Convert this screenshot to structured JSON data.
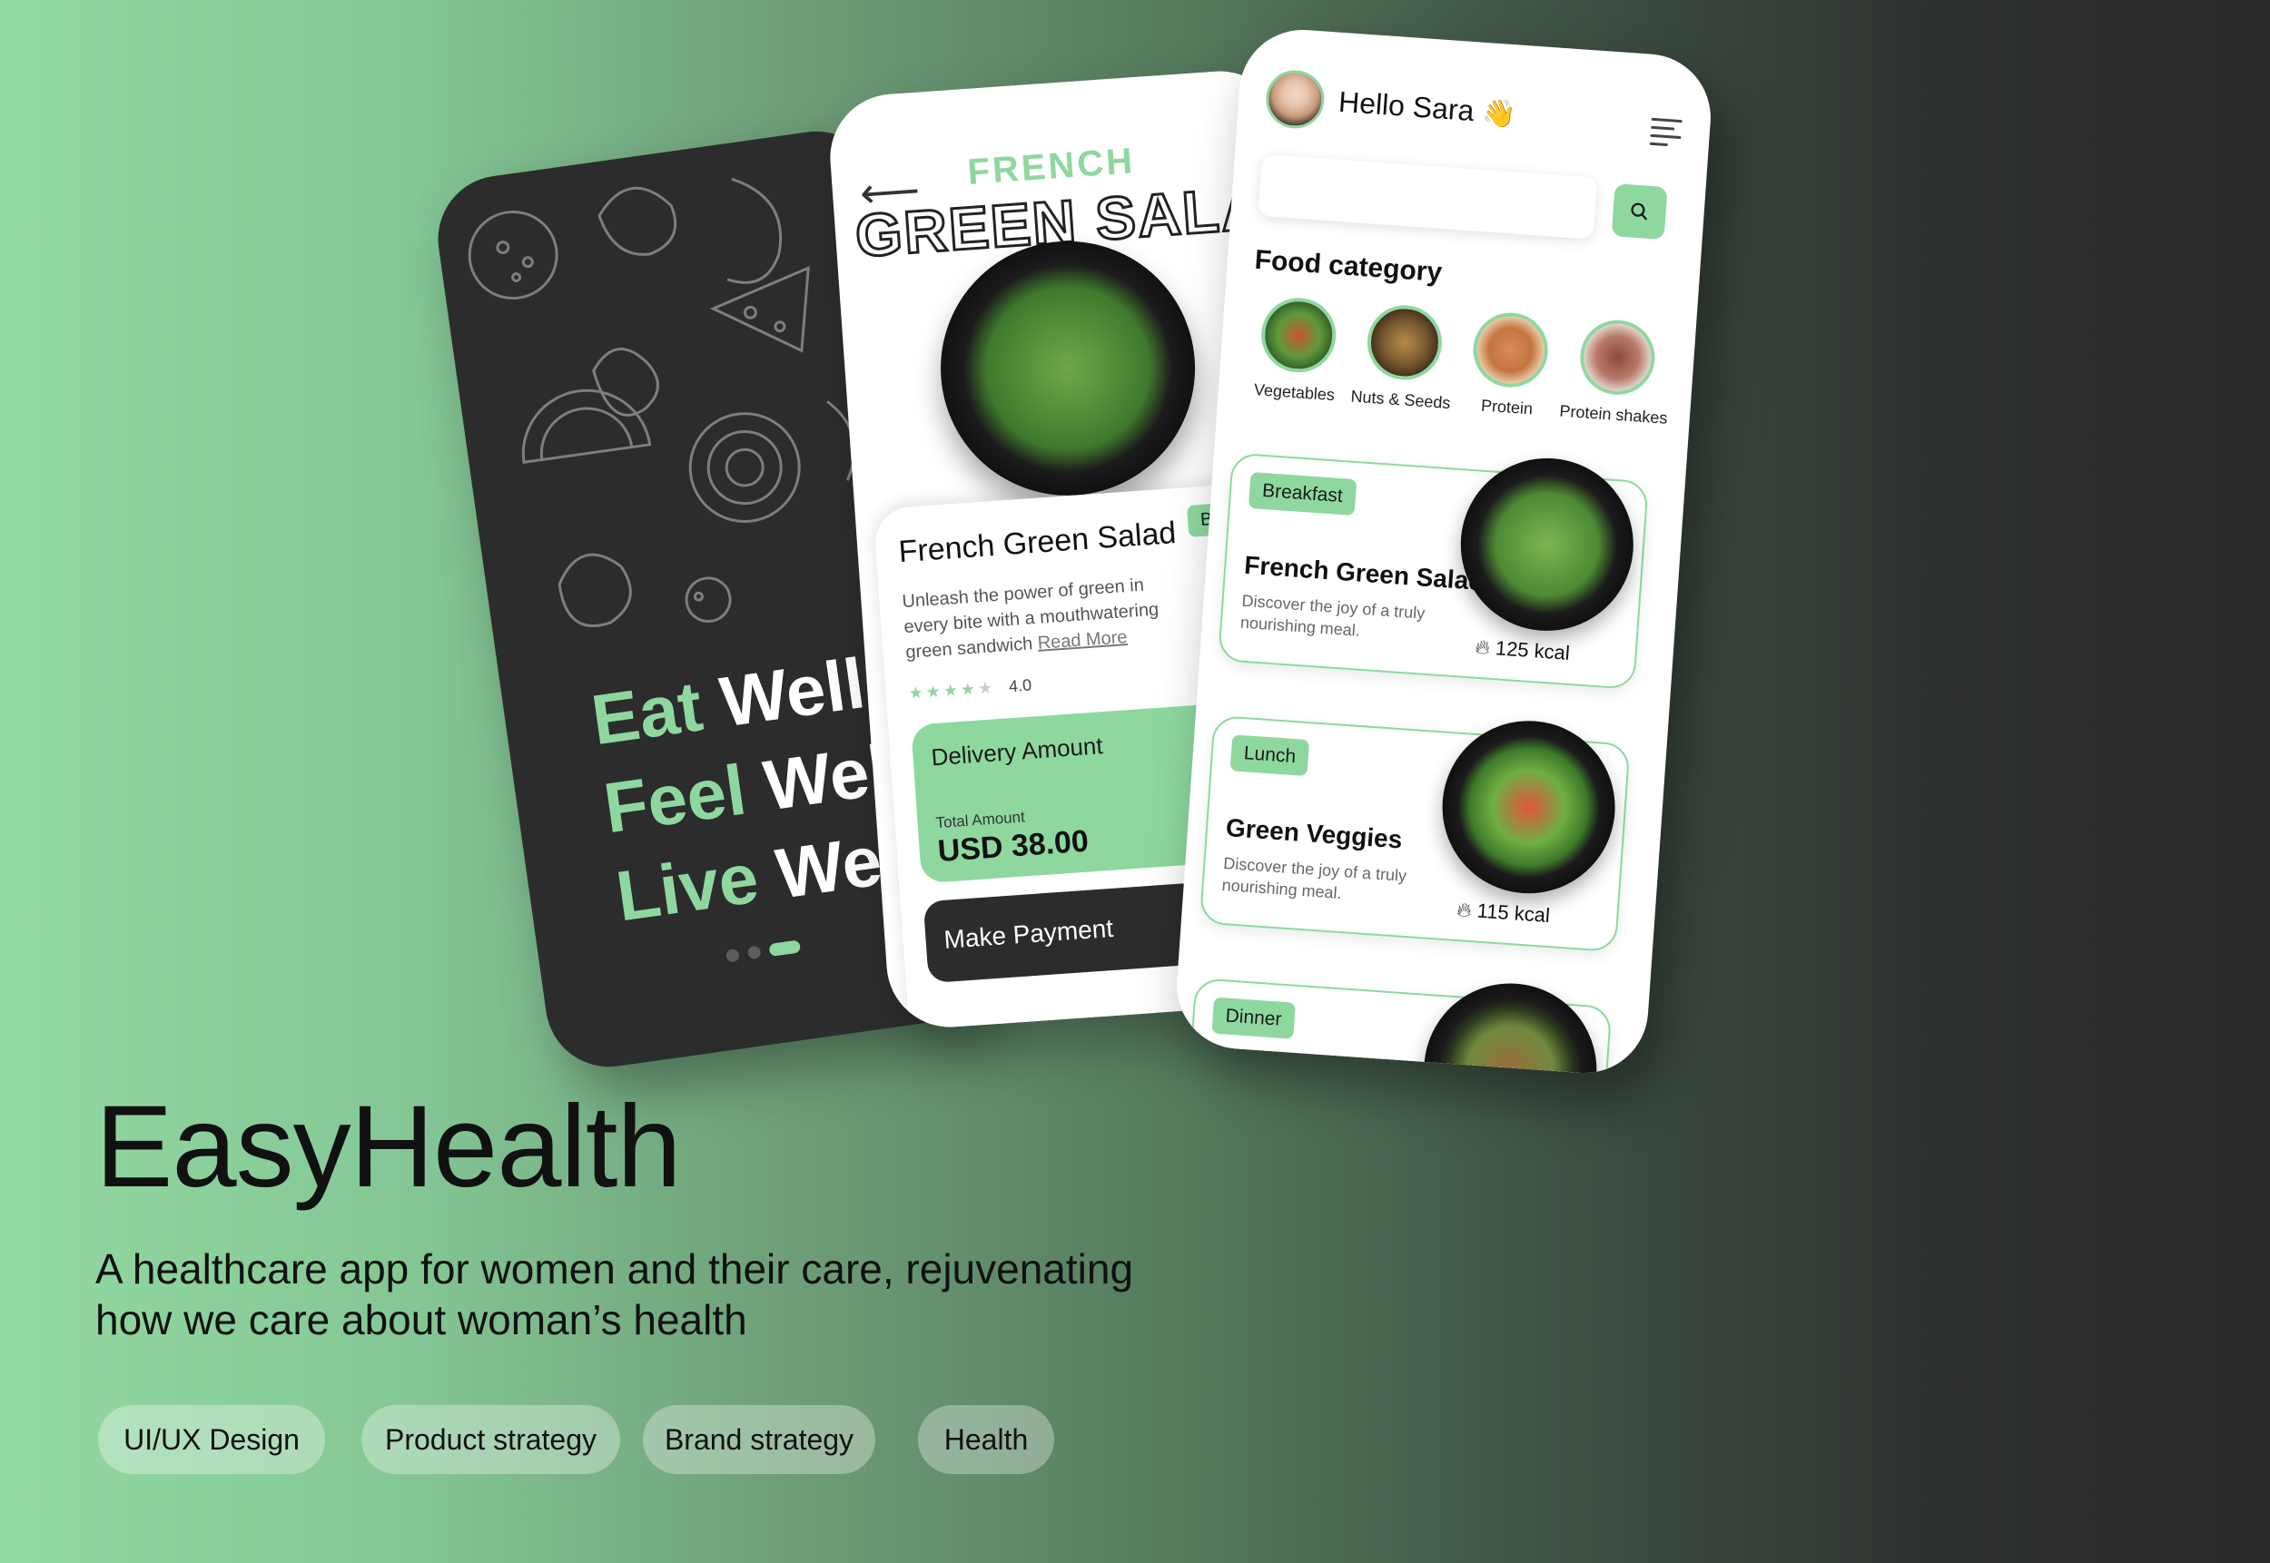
{
  "colors": {
    "accent": "#8ed8a0",
    "dark_card": "#2d2c2c",
    "white": "#ffffff"
  },
  "splash": {
    "slogan": [
      {
        "accent": "Eat",
        "word": "Well,"
      },
      {
        "accent": "Feel",
        "word": "Well"
      },
      {
        "accent": "Live",
        "word": "Well"
      }
    ],
    "pager_pages": 3,
    "pager_active": 3
  },
  "detail": {
    "back_icon": "arrow-left-icon",
    "subtitle": "FRENCH",
    "title_outline": "GREEN SALAD",
    "name": "French Green Salad",
    "tag": "Bre",
    "description": "Unleash the power of green in every bite with a mouthwatering green sandwich",
    "read_more": "Read More",
    "rating_stars": 4,
    "rating_value": "4.0",
    "delivery_label": "Delivery Amount",
    "total_label": "Total Amount",
    "total_value": "USD 38.00",
    "pay_button": "Make Payment"
  },
  "home": {
    "greeting": "Hello Sara",
    "wave": "👋",
    "menu_icon": "menu-icon",
    "search_icon": "search-icon",
    "search_placeholder": "",
    "category_title": "Food category",
    "categories": [
      "Vegetables",
      "Nuts & Seeds",
      "Protein",
      "Protein shakes"
    ],
    "meals": [
      {
        "tag": "Breakfast",
        "name": "French Green Salad",
        "desc": "Discover the joy of a truly nourishing meal.",
        "kcal": "125 kcal"
      },
      {
        "tag": "Lunch",
        "name": "Green Veggies",
        "desc": "Discover the joy of a truly nourishing meal.",
        "kcal": "115 kcal"
      },
      {
        "tag": "Dinner",
        "name": "",
        "desc": "",
        "kcal": ""
      }
    ]
  },
  "project": {
    "title": "EasyHealth",
    "description_line1": "A healthcare app for women and their care, rejuvenating",
    "description_line2": "how we care about woman’s health",
    "tags": [
      "UI/UX Design",
      "Product strategy",
      "Brand strategy",
      "Health"
    ]
  }
}
